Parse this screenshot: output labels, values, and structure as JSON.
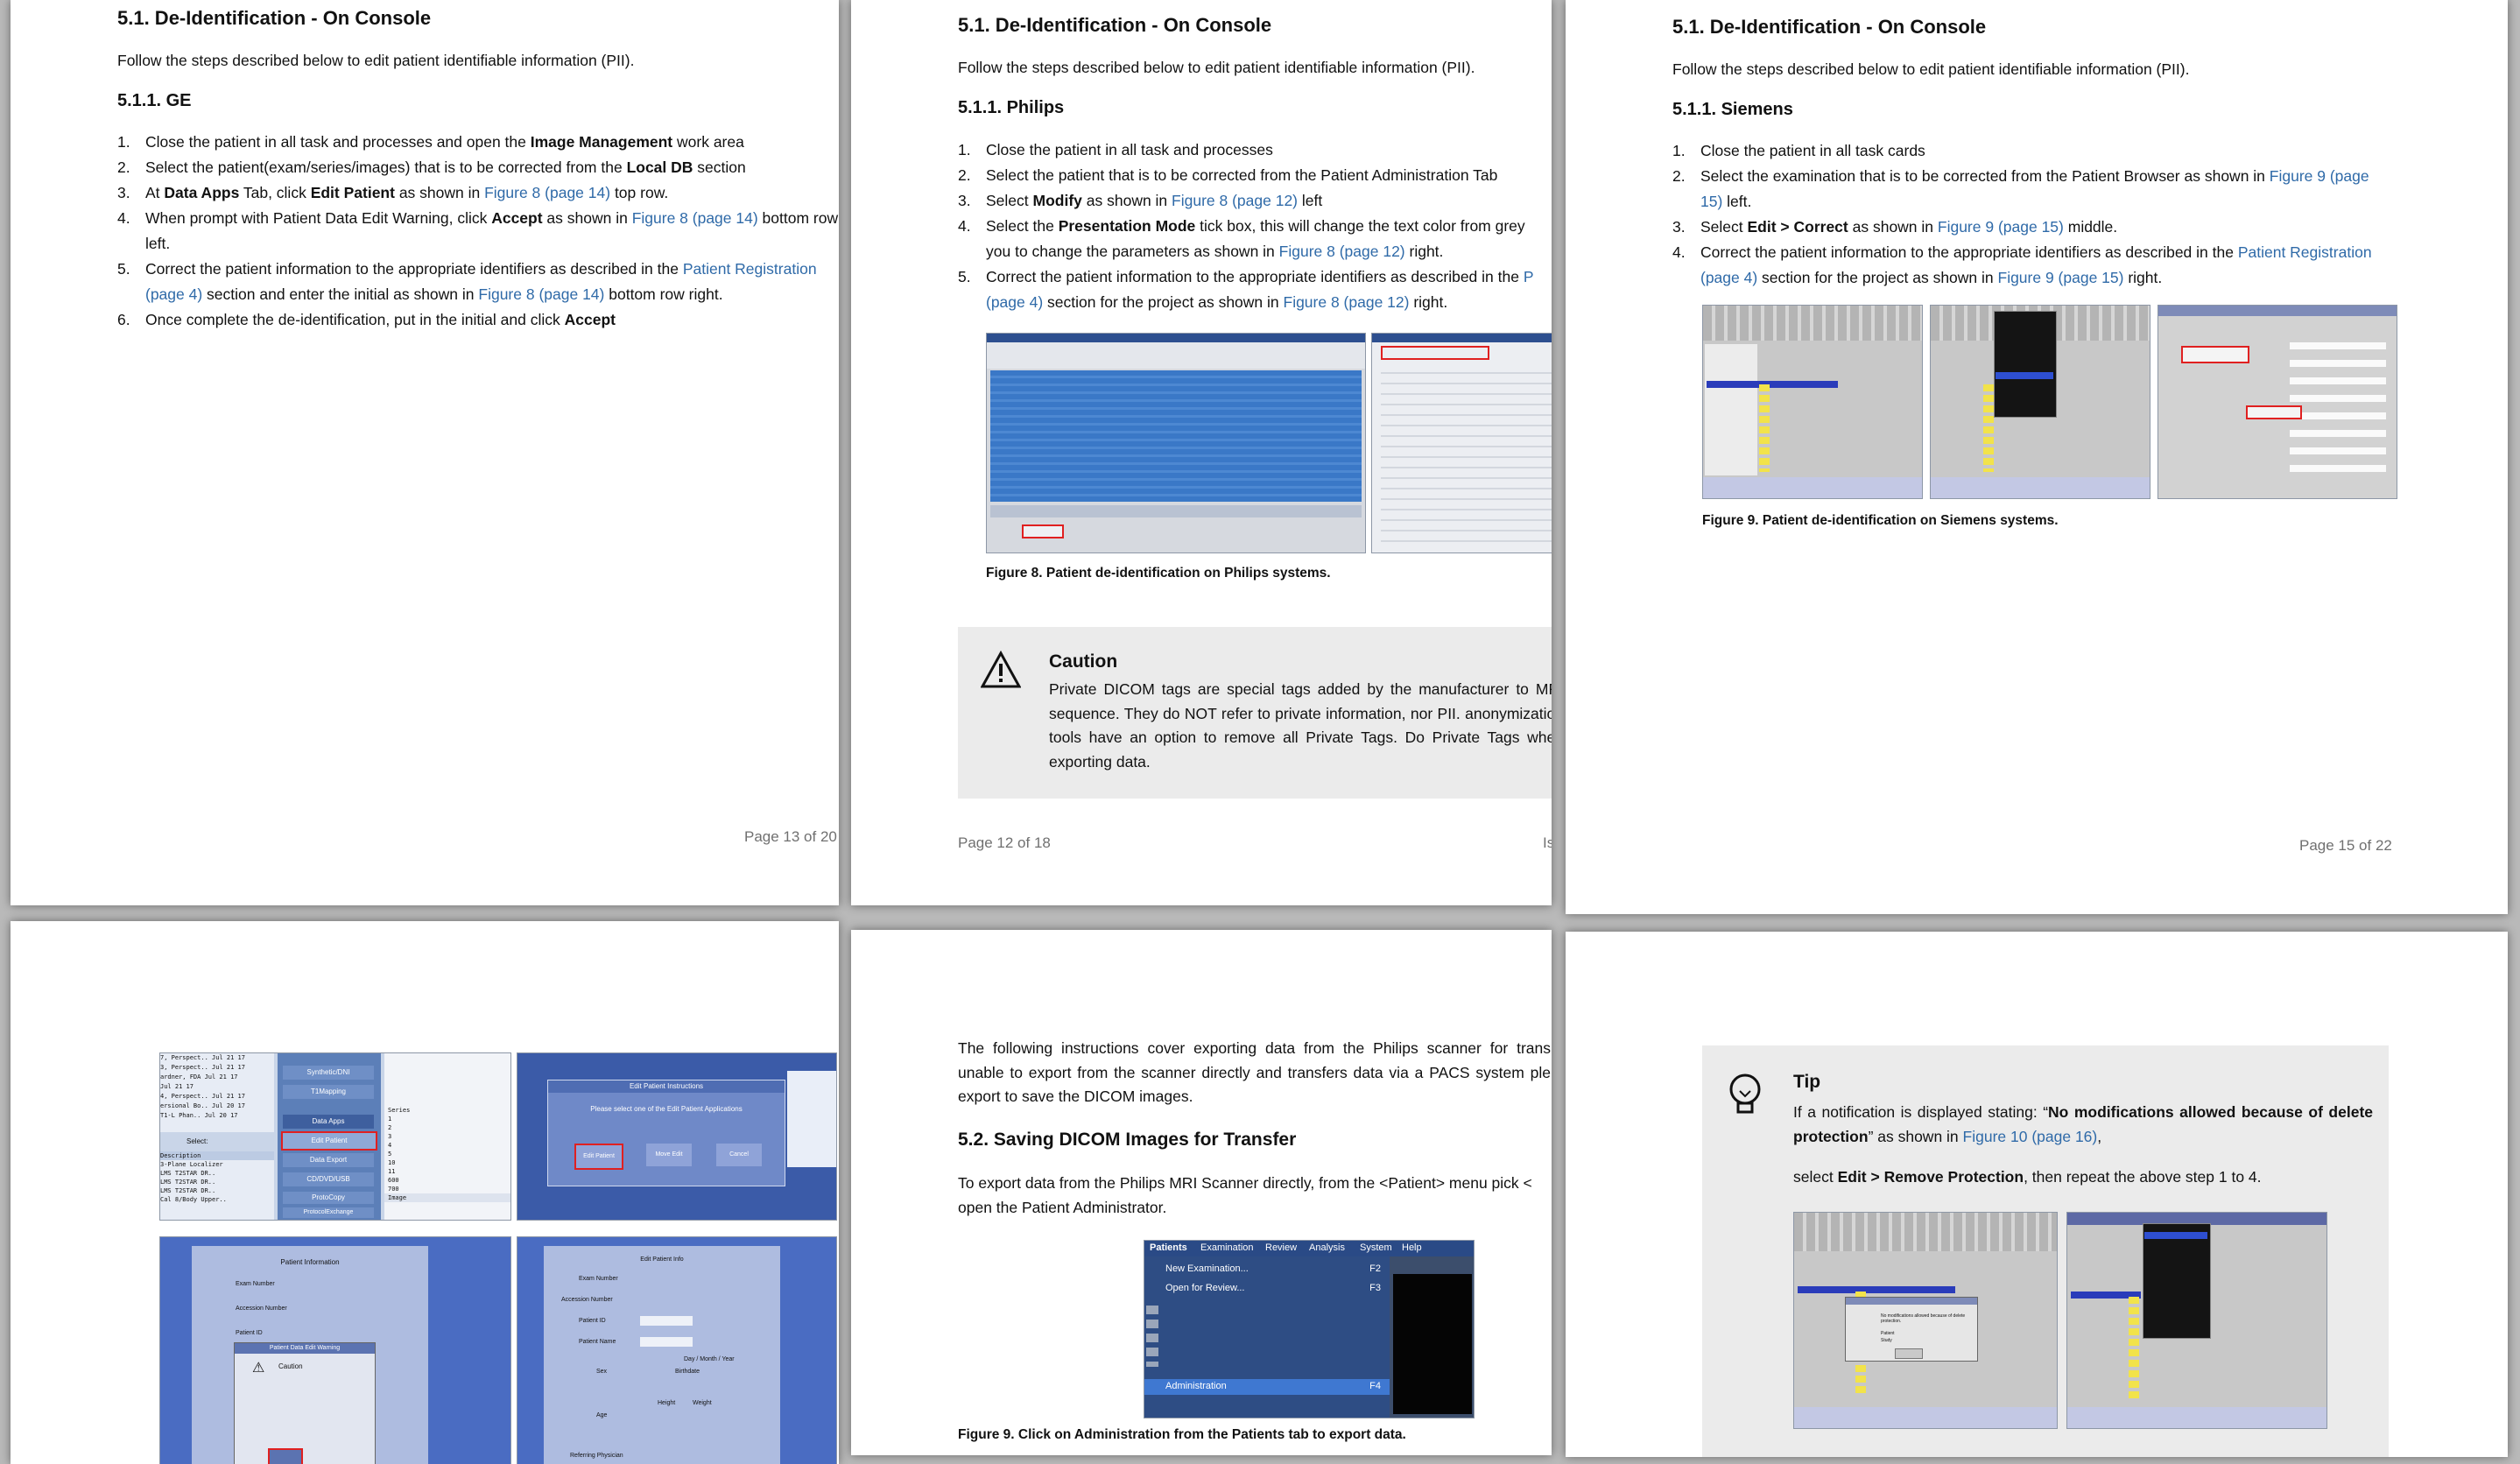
{
  "page1": {
    "section_title": "5.1. De-Identification - On Console",
    "intro": "Follow the steps described below to edit patient identifiable information (PII).",
    "subsection_title": "5.1.1. GE",
    "steps": [
      {
        "n": "1.",
        "a": "Close the patient in all task and processes and open the ",
        "b": "Image Management",
        "c": " work area"
      },
      {
        "n": "2.",
        "a": "Select the patient(exam/series/images) that is to be corrected from the ",
        "b": "Local DB",
        "c": " section"
      },
      {
        "n": "3.",
        "a": "At ",
        "b": "Data Apps",
        "c": " Tab, click ",
        "d": "Edit Patient",
        "e": " as shown in ",
        "link": "Figure 8 (page 14)",
        "f": " top row."
      },
      {
        "n": "4.",
        "a": "When prompt with Patient Data Edit Warning, click ",
        "b": "Accept",
        "c": " as shown in ",
        "link": "Figure 8 (page 14)",
        "d": " bottom row left."
      },
      {
        "n": "5.",
        "a": "Correct the patient information to the appropriate identifiers as described in the ",
        "link": "Patient Registration (page 4)",
        "b": " section and enter the initial as shown in ",
        "link2": "Figure 8 (page 14)",
        "c": " bottom row right."
      },
      {
        "n": "6.",
        "a": "Once complete the de-identification, put in the initial and click ",
        "b": "Accept"
      }
    ],
    "page_number": "Page 13 of 20"
  },
  "page2": {
    "section_title": "5.1. De-Identification - On Console",
    "intro": "Follow the steps described below to edit patient identifiable information (PII).",
    "subsection_title": "5.1.1. Philips",
    "steps": [
      {
        "n": "1.",
        "a": "Close the patient in all task and processes"
      },
      {
        "n": "2.",
        "a": "Select the patient that is to be corrected from the Patient Administration Tab"
      },
      {
        "n": "3.",
        "a": "Select ",
        "b": "Modify",
        "c": " as shown in ",
        "link": "Figure 8 (page 12)",
        "d": " left"
      },
      {
        "n": "4.",
        "a": "Select the ",
        "b": "Presentation Mode",
        "c": " tick box, this will change the text color from grey you to change the parameters as shown in ",
        "link": "Figure 8 (page 12)",
        "d": " right."
      },
      {
        "n": "5.",
        "a": "Correct the patient information to the appropriate identifiers as described in the ",
        "link": "P (page 4)",
        "b": " section for the project as shown in ",
        "link2": "Figure 8 (page 12)",
        "c": " right."
      }
    ],
    "figure_caption": "Figure 8. Patient de-identification on Philips systems.",
    "caution_title": "Caution",
    "caution_text": "Private DICOM tags are special tags added by the manufacturer to MRI sequence. They do NOT refer to private information, nor PII. anonymization tools have an option to remove all Private Tags. Do Private Tags when exporting data.",
    "page_number": "Page 12 of 18",
    "page_number_right": "Is"
  },
  "page3": {
    "section_title": "5.1. De-Identification - On Console",
    "intro": "Follow the steps described below to edit patient identifiable information (PII).",
    "subsection_title": "5.1.1. Siemens",
    "steps": [
      {
        "n": "1.",
        "a": "Close the patient in all task cards"
      },
      {
        "n": "2.",
        "a": "Select the examination that is to be corrected from the Patient Browser as shown in ",
        "link": "Figure 9 (page 15)",
        "b": " left."
      },
      {
        "n": "3.",
        "a": "Select ",
        "b": "Edit > Correct",
        "c": " as shown in ",
        "link": "Figure 9 (page 15)",
        "d": " middle."
      },
      {
        "n": "4.",
        "a": "Correct the patient information to the appropriate identifiers as described in the ",
        "link": "Patient Registration (page 4)",
        "b": " section for the project as shown in ",
        "link2": "Figure 9 (page 15)",
        "c": " right."
      }
    ],
    "figure_caption": "Figure 9. Patient de-identification on Siemens systems.",
    "page_number": "Page 15 of 22"
  },
  "page4": {
    "ge_menu": {
      "rows": [
        "7, Perspect.. Jul 21 17",
        "3, Perspect.. Jul 21 17",
        "ardner, FDA Jul 21 17",
        "Jul 21 17",
        "4, Perspect.. Jul 21 17",
        "ersional Bo.. Jul 20 17",
        "T1-L Phan.. Jul 20 17"
      ],
      "buttons": [
        "Synthetic/DNI",
        "T1Mapping",
        "Data Apps",
        "Edit Patient",
        "Data Export",
        "CD/DVD/USB",
        "ProtoCopy",
        "ProtocolExchange"
      ],
      "select_label": "Select:",
      "desc_header": "Description",
      "desc_items": [
        "3-Plane Localizer",
        "LMS T2STAR DR..",
        "LMS T2STAR DR..",
        "LMS T2STAR DR..",
        "Cal 8/Body Upper.."
      ],
      "series_label": "Series",
      "series_nums": [
        "1",
        "2",
        "3",
        "4",
        "5",
        "10",
        "11",
        "600",
        "700"
      ],
      "image_label": "Image"
    },
    "ge_dialog": {
      "title": "Edit Patient Instructions",
      "prompt": "Please select one of the Edit Patient Applications",
      "buttons": [
        "Edit Patient",
        "Move Edit",
        "Cancel"
      ]
    },
    "ge_warning": {
      "header": "Patient Information",
      "fields": [
        "Exam Number",
        "Accession Number",
        "Patient ID"
      ],
      "warning_title": "Patient Data Edit Warning",
      "caution": "Caution"
    },
    "ge_edit": {
      "title": "Edit Patient Info",
      "fields": [
        "Exam Number",
        "Accession Number",
        "Patient ID",
        "Patient Name",
        "Sex",
        "Age",
        "Referring Physician"
      ],
      "birthdate": "Birthdate",
      "date_hint": "Day / Month / Year",
      "height": "Height",
      "weight": "Weight"
    }
  },
  "page5": {
    "export_intro": "The following instructions cover exporting data from the Philips scanner for trans unable to export from the scanner directly and transfers data via a PACS system ple export to save the DICOM images.",
    "section_title": "5.2. Saving DICOM Images for Transfer",
    "export_text": "To export data from the Philips MRI Scanner directly, from the <Patient> menu pick < open the Patient Administrator.",
    "menu": {
      "bar": [
        "Patients",
        "Examination",
        "Review",
        "Analysis",
        "System",
        "Help"
      ],
      "items": [
        {
          "label": "New Examination...",
          "key": "F2"
        },
        {
          "label": "Open for Review...",
          "key": "F3"
        }
      ],
      "admin": {
        "label": "Administration",
        "key": "F4"
      }
    },
    "figure_caption": "Figure 9. Click on Administration from the Patients tab to export data."
  },
  "page6": {
    "tip_title": "Tip",
    "tip_line1_a": "If a notification is displayed stating: “",
    "tip_line1_b": "No modifications allowed because of delete protection",
    "tip_line1_c": "” as shown in ",
    "tip_link": "Figure 10 (page 16)",
    "tip_line1_d": ",",
    "tip_line2_a": "select ",
    "tip_line2_b": "Edit > Remove Protection",
    "tip_line2_c": ", then repeat the above step 1 to 4.",
    "siemens_msg": {
      "title": "No modifications allowed because of delete protection.",
      "patient": "Patient",
      "study": "Study"
    }
  },
  "colors": {
    "link": "#2f6aa8",
    "philips_blue": "#3a78c7",
    "siemens_grey": "#c8c8c8",
    "callout_bg": "#ebebeb",
    "ge_blue": "#4f73c9"
  }
}
